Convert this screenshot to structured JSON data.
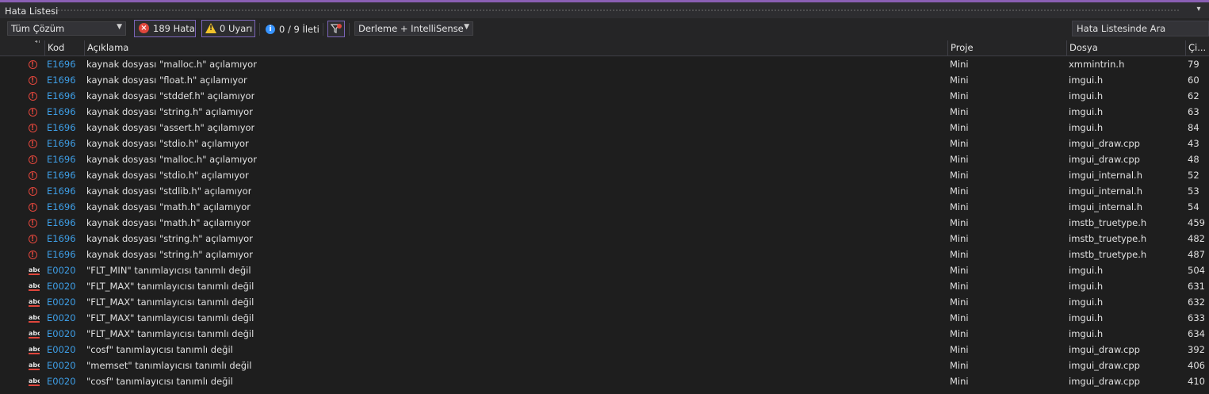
{
  "window": {
    "title": "Hata Listesi"
  },
  "toolbar": {
    "scope_value": "Tüm Çözüm",
    "errors_label": "189 Hata",
    "warnings_label": "0 Uyarı",
    "messages_label": "0 / 9 İleti",
    "build_filter_value": "Derleme + IntelliSense",
    "search_placeholder": "Hata Listesinde Ara"
  },
  "columns": {
    "code": "Kod",
    "description": "Açıklama",
    "project": "Proje",
    "file": "Dosya",
    "line": "Çi..."
  },
  "rows": [
    {
      "icon": "error-icon",
      "code": "E1696",
      "description": "kaynak dosyası \"malloc.h\" açılamıyor",
      "project": "Mini",
      "file": "xmmintrin.h",
      "line": "79"
    },
    {
      "icon": "error-icon",
      "code": "E1696",
      "description": "kaynak dosyası \"float.h\" açılamıyor",
      "project": "Mini",
      "file": "imgui.h",
      "line": "60"
    },
    {
      "icon": "error-icon",
      "code": "E1696",
      "description": "kaynak dosyası \"stddef.h\" açılamıyor",
      "project": "Mini",
      "file": "imgui.h",
      "line": "62"
    },
    {
      "icon": "error-icon",
      "code": "E1696",
      "description": "kaynak dosyası \"string.h\" açılamıyor",
      "project": "Mini",
      "file": "imgui.h",
      "line": "63"
    },
    {
      "icon": "error-icon",
      "code": "E1696",
      "description": "kaynak dosyası \"assert.h\" açılamıyor",
      "project": "Mini",
      "file": "imgui.h",
      "line": "84"
    },
    {
      "icon": "error-icon",
      "code": "E1696",
      "description": "kaynak dosyası \"stdio.h\" açılamıyor",
      "project": "Mini",
      "file": "imgui_draw.cpp",
      "line": "43"
    },
    {
      "icon": "error-icon",
      "code": "E1696",
      "description": "kaynak dosyası \"malloc.h\" açılamıyor",
      "project": "Mini",
      "file": "imgui_draw.cpp",
      "line": "48"
    },
    {
      "icon": "error-icon",
      "code": "E1696",
      "description": "kaynak dosyası \"stdio.h\" açılamıyor",
      "project": "Mini",
      "file": "imgui_internal.h",
      "line": "52"
    },
    {
      "icon": "error-icon",
      "code": "E1696",
      "description": "kaynak dosyası \"stdlib.h\" açılamıyor",
      "project": "Mini",
      "file": "imgui_internal.h",
      "line": "53"
    },
    {
      "icon": "error-icon",
      "code": "E1696",
      "description": "kaynak dosyası \"math.h\" açılamıyor",
      "project": "Mini",
      "file": "imgui_internal.h",
      "line": "54"
    },
    {
      "icon": "error-icon",
      "code": "E1696",
      "description": "kaynak dosyası \"math.h\" açılamıyor",
      "project": "Mini",
      "file": "imstb_truetype.h",
      "line": "459"
    },
    {
      "icon": "error-icon",
      "code": "E1696",
      "description": "kaynak dosyası \"string.h\" açılamıyor",
      "project": "Mini",
      "file": "imstb_truetype.h",
      "line": "482"
    },
    {
      "icon": "error-icon",
      "code": "E1696",
      "description": "kaynak dosyası \"string.h\" açılamıyor",
      "project": "Mini",
      "file": "imstb_truetype.h",
      "line": "487"
    },
    {
      "icon": "intellisense-icon",
      "code": "E0020",
      "description": "\"FLT_MIN\" tanımlayıcısı tanımlı değil",
      "project": "Mini",
      "file": "imgui.h",
      "line": "504"
    },
    {
      "icon": "intellisense-icon",
      "code": "E0020",
      "description": "\"FLT_MAX\" tanımlayıcısı tanımlı değil",
      "project": "Mini",
      "file": "imgui.h",
      "line": "631"
    },
    {
      "icon": "intellisense-icon",
      "code": "E0020",
      "description": "\"FLT_MAX\" tanımlayıcısı tanımlı değil",
      "project": "Mini",
      "file": "imgui.h",
      "line": "632"
    },
    {
      "icon": "intellisense-icon",
      "code": "E0020",
      "description": "\"FLT_MAX\" tanımlayıcısı tanımlı değil",
      "project": "Mini",
      "file": "imgui.h",
      "line": "633"
    },
    {
      "icon": "intellisense-icon",
      "code": "E0020",
      "description": "\"FLT_MAX\" tanımlayıcısı tanımlı değil",
      "project": "Mini",
      "file": "imgui.h",
      "line": "634"
    },
    {
      "icon": "intellisense-icon",
      "code": "E0020",
      "description": "\"cosf\" tanımlayıcısı tanımlı değil",
      "project": "Mini",
      "file": "imgui_draw.cpp",
      "line": "392"
    },
    {
      "icon": "intellisense-icon",
      "code": "E0020",
      "description": "\"memset\" tanımlayıcısı tanımlı değil",
      "project": "Mini",
      "file": "imgui_draw.cpp",
      "line": "406"
    },
    {
      "icon": "intellisense-icon",
      "code": "E0020",
      "description": "\"cosf\" tanımlayıcısı tanımlı değil",
      "project": "Mini",
      "file": "imgui_draw.cpp",
      "line": "410"
    }
  ],
  "colors": {
    "accent": "#8a5fb4",
    "error": "#e0463c",
    "warning": "#f0c22b",
    "info": "#3794ff",
    "code_link": "#3e9ee6"
  }
}
